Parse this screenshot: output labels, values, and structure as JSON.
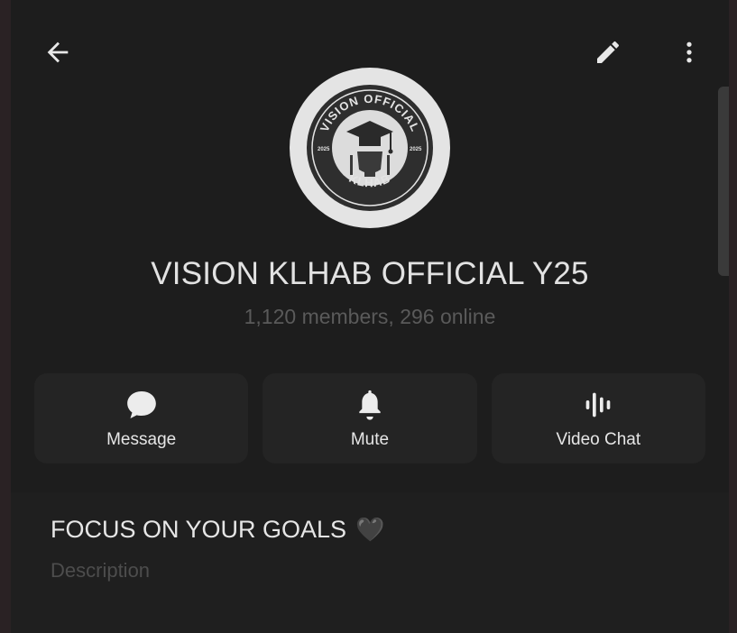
{
  "header": {
    "back_icon": "arrow-left-icon",
    "edit_icon": "pencil-icon",
    "more_icon": "more-vertical-icon"
  },
  "group": {
    "name": "VISION KLHAB OFFICIAL Y25",
    "status": "1,120 members, 296 online",
    "avatar": {
      "top_text": "VISION OFFICIAL",
      "bottom_text": "KLHAB",
      "left_year": "2025",
      "right_year": "2025"
    }
  },
  "actions": [
    {
      "label": "Message",
      "icon": "chat-bubble-icon"
    },
    {
      "label": "Mute",
      "icon": "bell-icon"
    },
    {
      "label": "Video Chat",
      "icon": "voice-wave-icon"
    }
  ],
  "about": {
    "description": "FOCUS ON YOUR GOALS",
    "emoji": "🖤",
    "label": "Description"
  },
  "colors": {
    "background": "#1d1d1d",
    "card": "#242424",
    "text": "#e6e6e6",
    "muted": "#5a5a5a"
  }
}
